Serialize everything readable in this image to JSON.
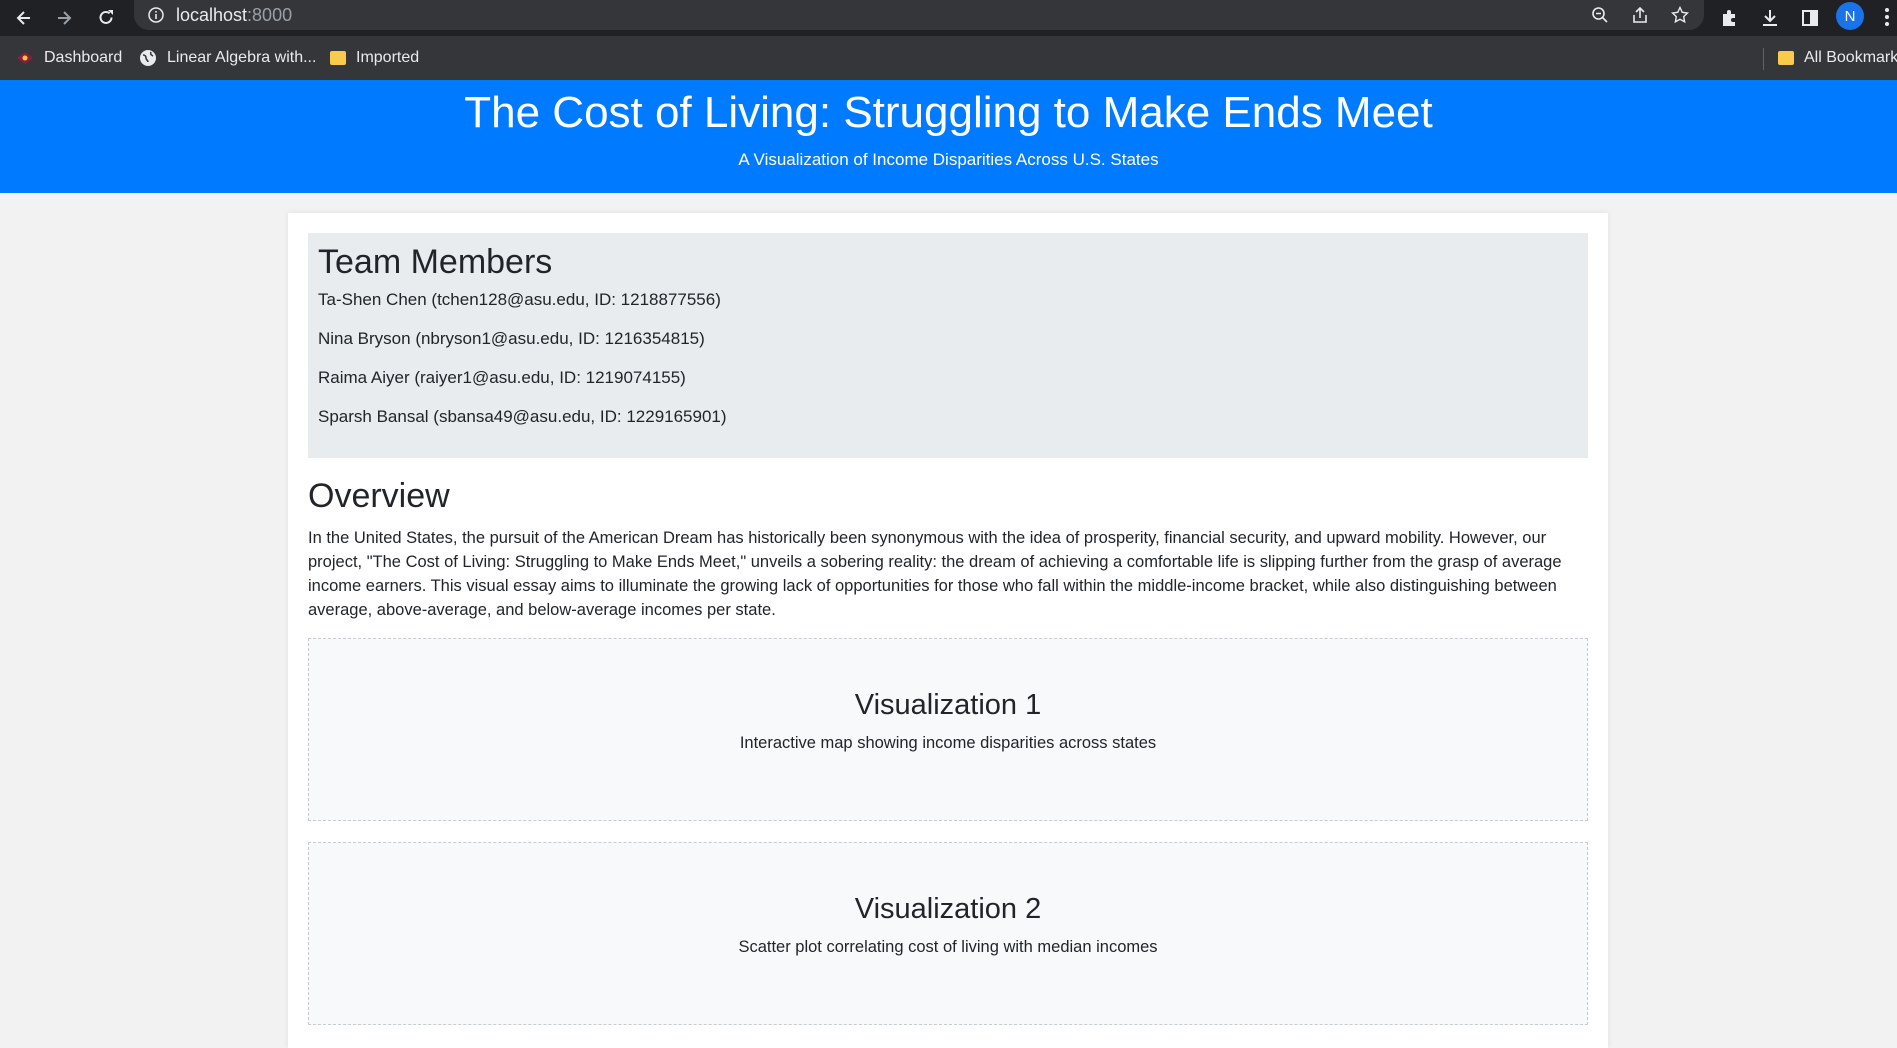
{
  "browser": {
    "url_host": "localhost",
    "url_port": ":8000",
    "profile_initial": "N",
    "bookmarks": [
      {
        "label": "Dashboard",
        "icon": "dashboard-favicon"
      },
      {
        "label": "Linear Algebra with...",
        "icon": "globe-icon"
      },
      {
        "label": "Imported",
        "icon": "folder-icon"
      }
    ],
    "all_bookmarks_label": "All Bookmarks"
  },
  "header": {
    "title": "The Cost of Living: Struggling to Make Ends Meet",
    "subtitle": "A Visualization of Income Disparities Across U.S. States"
  },
  "team": {
    "title": "Team Members",
    "members": [
      "Ta-Shen Chen (tchen128@asu.edu, ID: 1218877556)",
      "Nina Bryson (nbryson1@asu.edu, ID: 1216354815)",
      "Raima Aiyer (raiyer1@asu.edu, ID: 1219074155)",
      "Sparsh Bansal (sbansa49@asu.edu, ID: 1229165901)"
    ]
  },
  "overview": {
    "title": "Overview",
    "text": "In the United States, the pursuit of the American Dream has historically been synonymous with the idea of prosperity, financial security, and upward mobility. However, our project, \"The Cost of Living: Struggling to Make Ends Meet,\" unveils a sobering reality: the dream of achieving a comfortable life is slipping further from the grasp of average income earners. This visual essay aims to illuminate the growing lack of opportunities for those who fall within the middle-income bracket, while also distinguishing between average, above-average, and below-average incomes per state."
  },
  "visualizations": [
    {
      "title": "Visualization 1",
      "description": "Interactive map showing income disparities across states"
    },
    {
      "title": "Visualization 2",
      "description": "Scatter plot correlating cost of living with median incomes"
    }
  ],
  "colors": {
    "header_bg": "#007bff",
    "team_bg": "#e9ecef",
    "viz_bg": "#f8f9fa"
  }
}
